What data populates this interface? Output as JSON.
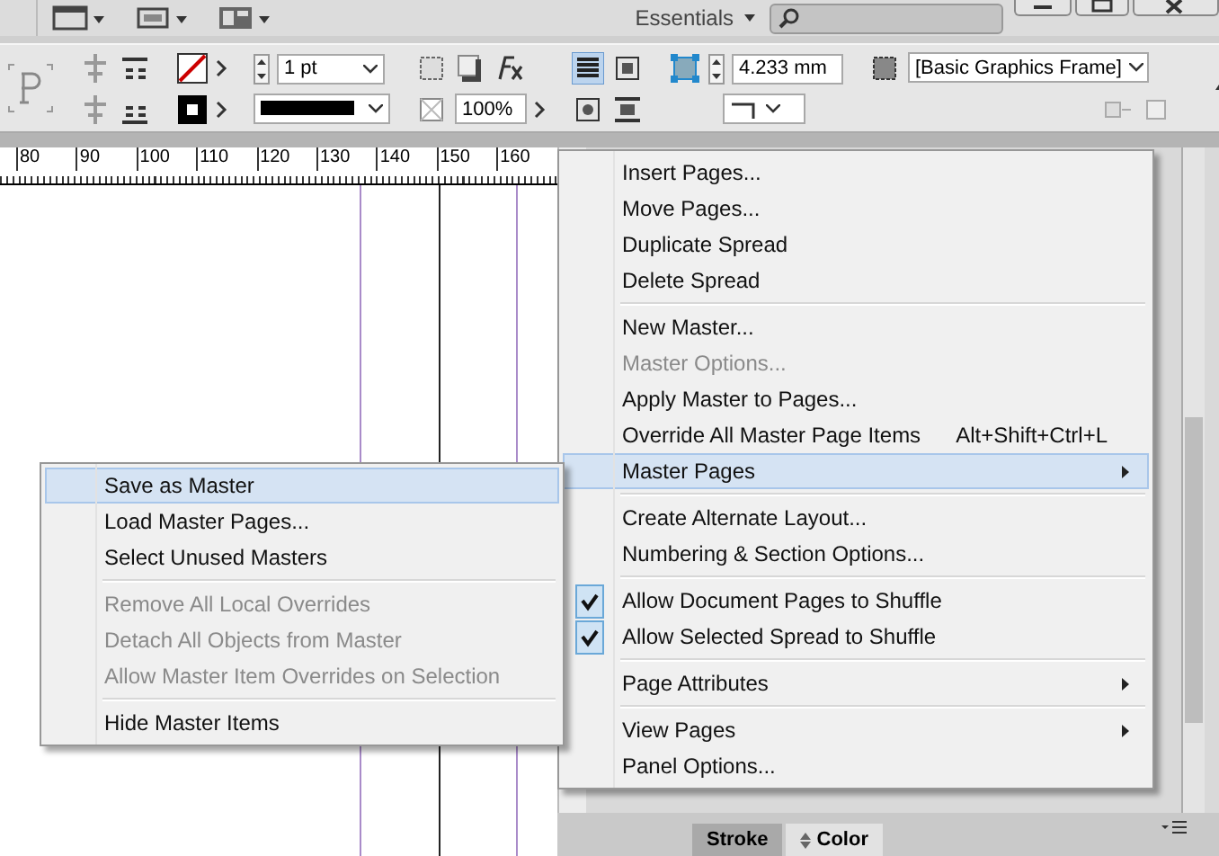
{
  "top_bar": {
    "workspace": "Essentials"
  },
  "control_bar": {
    "stroke_weight": "1 pt",
    "opacity": "100%",
    "dimension": "4.233 mm",
    "object_style": "[Basic Graphics Frame]"
  },
  "ruler": {
    "labels": [
      "80",
      "90",
      "100",
      "110",
      "120",
      "130",
      "140",
      "150",
      "160"
    ]
  },
  "menu": {
    "items": [
      {
        "kind": "item",
        "label": "Insert Pages...",
        "disabled": false,
        "checked": false,
        "selected": false,
        "submenu": false
      },
      {
        "kind": "item",
        "label": "Move Pages...",
        "disabled": false,
        "checked": false,
        "selected": false,
        "submenu": false
      },
      {
        "kind": "item",
        "label": "Duplicate Spread",
        "disabled": false,
        "checked": false,
        "selected": false,
        "submenu": false
      },
      {
        "kind": "item",
        "label": "Delete Spread",
        "disabled": false,
        "checked": false,
        "selected": false,
        "submenu": false
      },
      {
        "kind": "separator"
      },
      {
        "kind": "item",
        "label": "New Master...",
        "disabled": false,
        "checked": false,
        "selected": false,
        "submenu": false
      },
      {
        "kind": "item",
        "label": "Master Options...",
        "disabled": true,
        "checked": false,
        "selected": false,
        "submenu": false
      },
      {
        "kind": "item",
        "label": "Apply Master to Pages...",
        "disabled": false,
        "checked": false,
        "selected": false,
        "submenu": false
      },
      {
        "kind": "item",
        "label": "Override All Master Page Items",
        "shortcut": "Alt+Shift+Ctrl+L",
        "disabled": false,
        "checked": false,
        "selected": false,
        "submenu": false
      },
      {
        "kind": "item",
        "label": "Master Pages",
        "disabled": false,
        "checked": false,
        "selected": true,
        "submenu": true
      },
      {
        "kind": "separator"
      },
      {
        "kind": "item",
        "label": "Create Alternate Layout...",
        "disabled": false,
        "checked": false,
        "selected": false,
        "submenu": false
      },
      {
        "kind": "item",
        "label": "Numbering & Section Options...",
        "disabled": false,
        "checked": false,
        "selected": false,
        "submenu": false
      },
      {
        "kind": "separator"
      },
      {
        "kind": "item",
        "label": "Allow Document Pages to Shuffle",
        "disabled": false,
        "checked": true,
        "selected": false,
        "submenu": false
      },
      {
        "kind": "item",
        "label": "Allow Selected Spread to Shuffle",
        "disabled": false,
        "checked": true,
        "selected": false,
        "submenu": false
      },
      {
        "kind": "separator"
      },
      {
        "kind": "item",
        "label": "Page Attributes",
        "disabled": false,
        "checked": false,
        "selected": false,
        "submenu": true
      },
      {
        "kind": "separator"
      },
      {
        "kind": "item",
        "label": "View Pages",
        "disabled": false,
        "checked": false,
        "selected": false,
        "submenu": true
      },
      {
        "kind": "item",
        "label": "Panel Options...",
        "disabled": false,
        "checked": false,
        "selected": false,
        "submenu": false
      }
    ]
  },
  "submenu": {
    "items": [
      {
        "kind": "item",
        "label": "Save as Master",
        "disabled": false,
        "checked": false,
        "selected": true,
        "submenu": false
      },
      {
        "kind": "item",
        "label": "Load Master Pages...",
        "disabled": false,
        "checked": false,
        "selected": false,
        "submenu": false
      },
      {
        "kind": "item",
        "label": "Select Unused Masters",
        "disabled": false,
        "checked": false,
        "selected": false,
        "submenu": false
      },
      {
        "kind": "separator"
      },
      {
        "kind": "item",
        "label": "Remove All Local Overrides",
        "disabled": true,
        "checked": false,
        "selected": false,
        "submenu": false
      },
      {
        "kind": "item",
        "label": "Detach All Objects from Master",
        "disabled": true,
        "checked": false,
        "selected": false,
        "submenu": false
      },
      {
        "kind": "item",
        "label": "Allow Master Item Overrides on Selection",
        "disabled": true,
        "checked": false,
        "selected": false,
        "submenu": false
      },
      {
        "kind": "separator"
      },
      {
        "kind": "item",
        "label": "Hide Master Items",
        "disabled": false,
        "checked": false,
        "selected": false,
        "submenu": false
      }
    ]
  },
  "panel_tabs": [
    {
      "label": "Stroke",
      "selected": false
    },
    {
      "label": "Color",
      "selected": true
    }
  ]
}
